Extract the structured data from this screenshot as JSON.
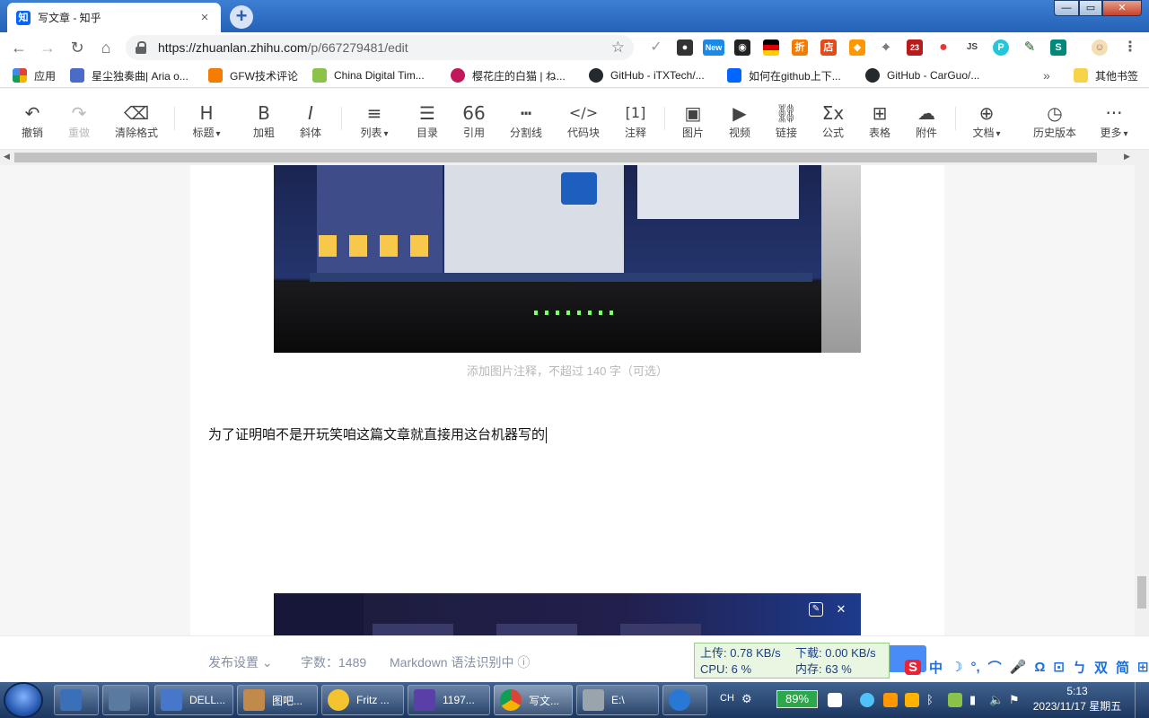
{
  "browser": {
    "tab_title": "写文章 - 知乎",
    "favicon_text": "知",
    "tab_close": "×",
    "new_tab": "+",
    "window_controls": {
      "minimize": "—",
      "maximize": "▭",
      "close": "✕"
    },
    "nav": {
      "back": "←",
      "forward": "→",
      "reload": "↻",
      "home": "⌂"
    },
    "url_host": "https://zhuanlan.zhihu.com",
    "url_path": "/p/667279481/edit",
    "extension_badges": {
      "new": "New",
      "count": "23",
      "js": "JS"
    }
  },
  "bookmarks": [
    {
      "label": "应用",
      "color": "#db4437"
    },
    {
      "label": "星尘独奏曲| Aria o...",
      "color": "#4a6cc8"
    },
    {
      "label": "GFW技术评论",
      "color": "#f57c00"
    },
    {
      "label": "China Digital Tim...",
      "color": "#8bc34a"
    },
    {
      "label": "樱花庄的白猫 | ね...",
      "color": "#c2185b"
    },
    {
      "label": "GitHub - iTXTech/...",
      "color": "#24292e"
    },
    {
      "label": "如何在github上下...",
      "color": "#0066ff"
    },
    {
      "label": "GitHub - CarGuo/...",
      "color": "#24292e"
    }
  ],
  "bookmarks_more": "»",
  "bookmarks_other": "其他书签",
  "editor_toolbar": {
    "tools": [
      {
        "icon": "↶",
        "label": "撤销"
      },
      {
        "icon": "↷",
        "label": "重做"
      },
      {
        "icon": "⌫",
        "label": "清除格式"
      },
      {
        "icon": "H",
        "label": "标题"
      },
      {
        "icon": "B",
        "label": "加粗"
      },
      {
        "icon": "I",
        "label": "斜体"
      },
      {
        "icon": "≡",
        "label": "列表"
      },
      {
        "icon": "☰",
        "label": "目录"
      },
      {
        "icon": "66",
        "label": "引用"
      },
      {
        "icon": "┅",
        "label": "分割线"
      },
      {
        "icon": "</>",
        "label": "代码块"
      },
      {
        "icon": "[1]",
        "label": "注释"
      },
      {
        "icon": "▣",
        "label": "图片"
      },
      {
        "icon": "▶",
        "label": "视频"
      },
      {
        "icon": "⛓",
        "label": "链接"
      },
      {
        "icon": "Σx",
        "label": "公式"
      },
      {
        "icon": "⊞",
        "label": "表格"
      },
      {
        "icon": "☁",
        "label": "附件"
      },
      {
        "icon": "⊕",
        "label": "文档"
      },
      {
        "icon": "◷",
        "label": "历史版本"
      },
      {
        "icon": "···",
        "label": "更多"
      }
    ]
  },
  "content": {
    "image_caption_placeholder": "添加图片注释，不超过 140 字（可选）",
    "paragraph": "为了证明咱不是开玩笑咱这篇文章就直接用这台机器写的"
  },
  "footer": {
    "publish_settings": "发布设置",
    "word_count": "字数：1489",
    "markdown_status": "Markdown 语法识别中"
  },
  "net_widget": {
    "upload": "上传: 0.78 KB/s",
    "download": "下载: 0.00 KB/s",
    "cpu": "CPU: 6 %",
    "memory": "内存: 63 %"
  },
  "ime_bar": [
    "S",
    "中",
    "☽",
    "°,",
    "⌒",
    "🎤",
    "Ω",
    "⊡",
    "ㄅ",
    "双",
    "简",
    "⊞"
  ],
  "taskbar": {
    "apps": [
      {
        "label": "",
        "color": "#3b6fb8"
      },
      {
        "label": "",
        "color": "#5a7aa0"
      },
      {
        "label": "DELL...",
        "color": "#4677c9"
      },
      {
        "label": "图吧...",
        "color": "#c28a4a"
      },
      {
        "label": "Fritz ...",
        "color": "#f4c430"
      },
      {
        "label": "1197...",
        "color": "#5b3fa8"
      },
      {
        "label": "写文...",
        "color": "#e04b3b"
      },
      {
        "label": "E:\\",
        "color": "#9aa4ad"
      },
      {
        "label": "",
        "color": "#2a78d6"
      }
    ],
    "language": "CH",
    "battery": "89%",
    "time": "5:13",
    "date": "2023/11/17 星期五"
  },
  "colors": {
    "accent": "#0066ff",
    "tabstrip": "#2462b7",
    "taskbar": "#1c3760"
  }
}
